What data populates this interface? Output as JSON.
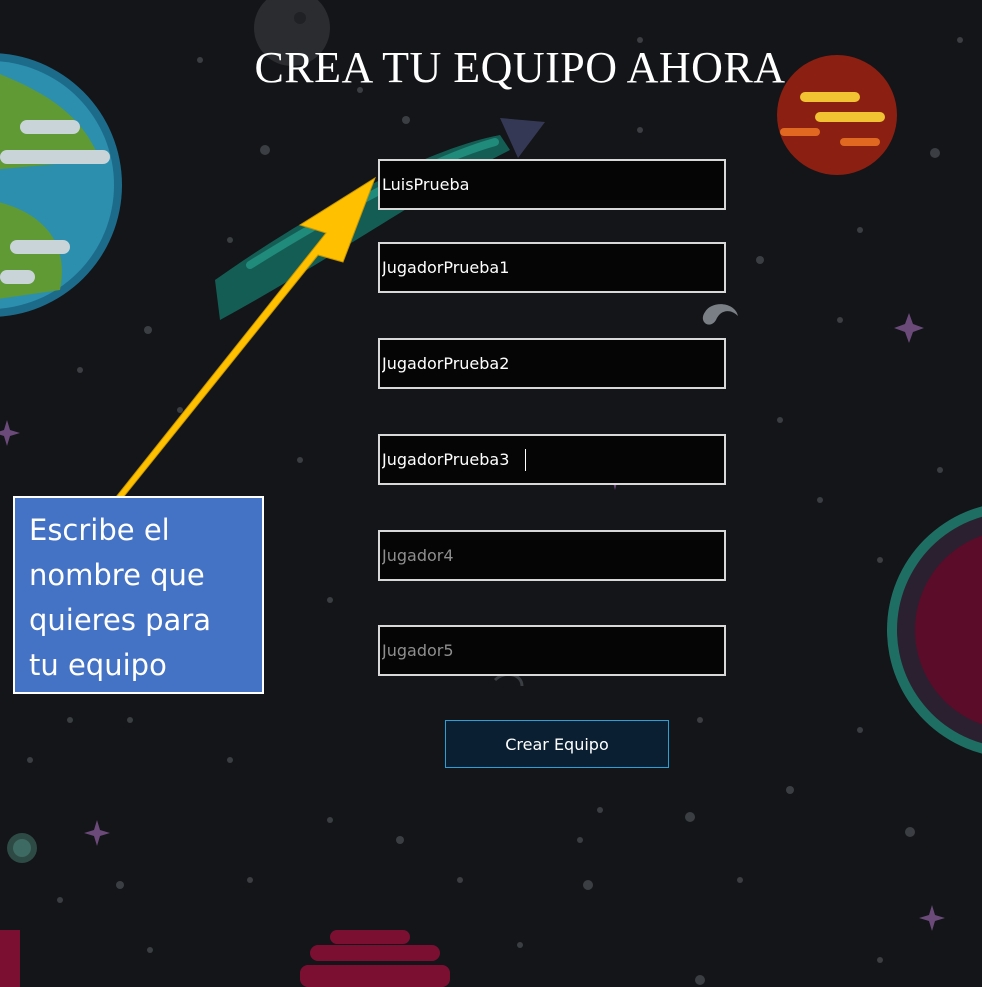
{
  "page": {
    "title": "CREA TU EQUIPO AHORA"
  },
  "form": {
    "team_name_value": "LuisPrueba",
    "player1_value": "JugadorPrueba1",
    "player2_value": "JugadorPrueba2",
    "player3_value": "JugadorPrueba3",
    "player4_value": "",
    "player4_placeholder": "Jugador4",
    "player5_value": "",
    "player5_placeholder": "Jugador5",
    "submit_label": "Crear Equipo"
  },
  "annotation": {
    "callout_text": "Escribe el nombre que quieres para tu equipo",
    "arrow_color": "#ffc000",
    "callout_color": "#4472c4"
  },
  "colors": {
    "background": "#131518",
    "field_border": "#d8d8d8",
    "button_border": "#2a9fd8"
  }
}
